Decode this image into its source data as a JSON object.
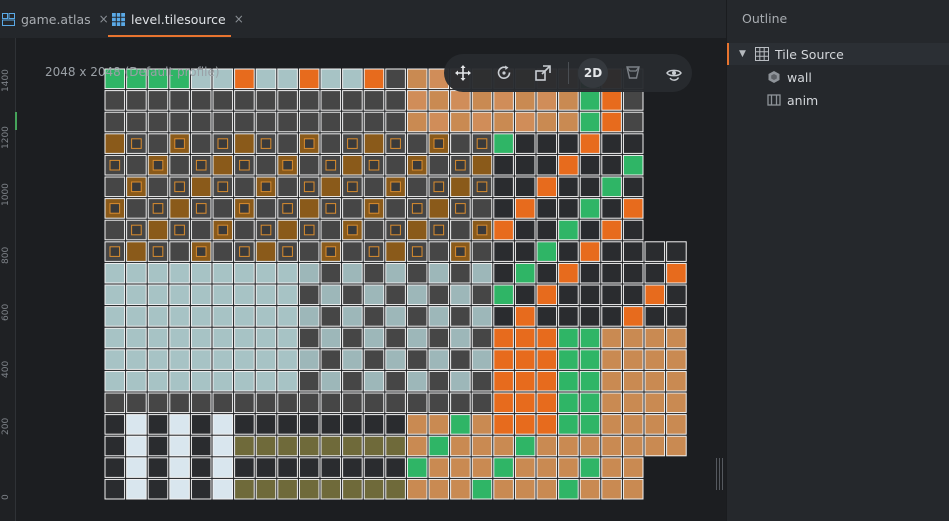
{
  "tabs": [
    {
      "label": "game.atlas",
      "icon": "atlas-icon",
      "close": "×"
    },
    {
      "label": "level.tilesource",
      "icon": "tilesource-icon",
      "close": "×",
      "active": true
    }
  ],
  "editor": {
    "profile_label": "2048 x 2048 (Default profile)",
    "ruler_labels": [
      "1400",
      "1200",
      "1000",
      "800",
      "600",
      "400",
      "200",
      "0"
    ]
  },
  "toolbar": {
    "tools": [
      {
        "name": "move-tool",
        "icon": "move-icon"
      },
      {
        "name": "rotate-tool",
        "icon": "rotate-icon"
      },
      {
        "name": "scale-tool",
        "icon": "scale-icon"
      },
      {
        "name": "2d-toggle",
        "label": "2D"
      },
      {
        "name": "visibility-filter",
        "icon": "filter-icon"
      },
      {
        "name": "camera-reset",
        "icon": "eye-reset-icon"
      }
    ]
  },
  "outline": {
    "title": "Outline",
    "root": {
      "label": "Tile Source",
      "icon": "grid-icon"
    },
    "children": [
      {
        "label": "wall",
        "icon": "collision-hexagon-icon"
      },
      {
        "label": "anim",
        "icon": "animation-icon"
      }
    ]
  },
  "colors": {
    "accent": "#e8742f",
    "tile_gray": "#464646",
    "tile_ice": "#a7c3c5",
    "tile_orange": "#e76b1d",
    "tile_green": "#2fb566",
    "tile_brown": "#c98a52"
  }
}
